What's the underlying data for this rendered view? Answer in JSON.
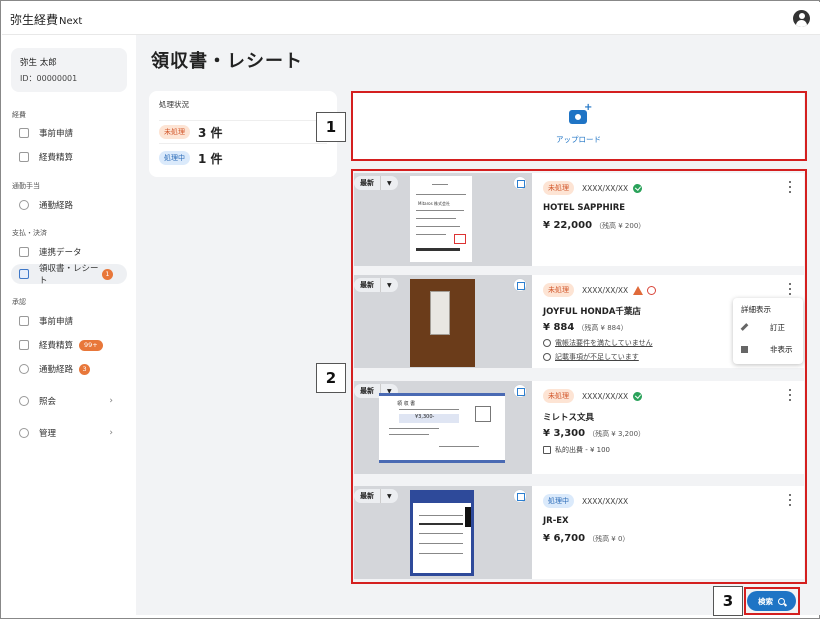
{
  "app": {
    "logo_main": "弥生経費",
    "logo_suffix": "Next"
  },
  "user": {
    "name": "弥生 太郎",
    "id": "ID：00000001"
  },
  "sidebar": {
    "sections": {
      "expense": "経費",
      "commute": "通勤手当",
      "payment": "支払・決済",
      "approval": "承認"
    },
    "items": {
      "pre_request": "事前申請",
      "expense_settle": "経費精算",
      "commute_route": "通勤経路",
      "linked_data": "連携データ",
      "receipts": "領収書・レシート",
      "receipts_badge": "1",
      "approval_pre_request": "事前申請",
      "approval_expense": "経費精算",
      "approval_expense_badge": "99+",
      "approval_commute": "通勤経路",
      "approval_commute_badge": "3",
      "inquiry": "照会",
      "admin": "管理"
    }
  },
  "main": {
    "title": "領収書・レシート",
    "status_card": {
      "title": "処理状況",
      "rows": [
        {
          "chip": "未処理",
          "count": "3 件"
        },
        {
          "chip": "処理中",
          "count": "1 件"
        }
      ]
    },
    "upload_label": "アップロード",
    "sort_label": "最新",
    "receipts": [
      {
        "status": "未処理",
        "date": "XXXX/XX/XX",
        "store": "HOTEL SAPPHIRE",
        "amount": "¥ 22,000",
        "balance": "（残高 ¥ 200）",
        "thumb_text": "Mitaros 株式会社"
      },
      {
        "status": "未処理",
        "date": "XXXX/XX/XX",
        "store": "JOYFUL HONDA千葉店",
        "amount": "¥ 884",
        "balance": "（残高 ¥ 884）",
        "note1": "電帳法要件を満たしていません",
        "note2": "記載事項が不足しています"
      },
      {
        "status": "未処理",
        "date": "XXXX/XX/XX",
        "store": "ミレトス文具",
        "amount": "¥ 3,300",
        "balance": "（残高 ¥ 3,200）",
        "note1": "私的出費 - ¥ 100",
        "thumb_title": "領 収 書",
        "thumb_amount": "¥3,300-"
      },
      {
        "status": "処理中",
        "date": "XXXX/XX/XX",
        "store": "JR-EX",
        "amount": "¥ 6,700",
        "balance": "（残高 ¥ 0）"
      }
    ],
    "context_menu": {
      "title": "詳細表示",
      "edit": "訂正",
      "hide": "非表示"
    },
    "search_label": "検索"
  },
  "annotations": {
    "a1": "1",
    "a2": "2",
    "a3": "3"
  },
  "colors": {
    "accent": "#1f74c5",
    "annotation": "#d41f1f",
    "badge": "#e8773a"
  }
}
